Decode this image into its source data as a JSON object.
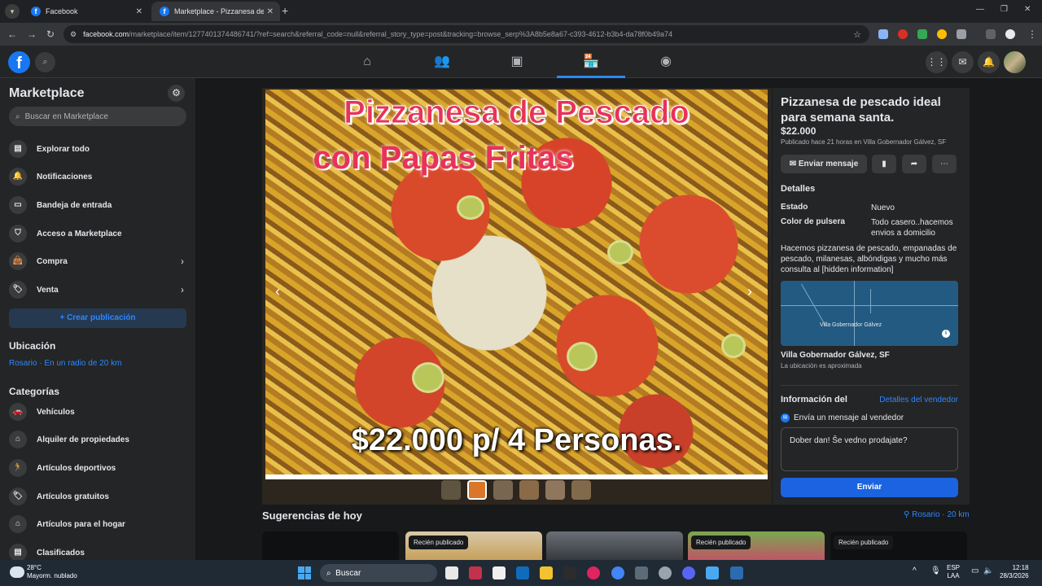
{
  "browser": {
    "tabs": [
      {
        "label": "Facebook",
        "active": false
      },
      {
        "label": "Marketplace - Pizzanesa de pesc",
        "active": true
      }
    ],
    "url_host": "facebook.com",
    "url_path": "/marketplace/item/1277401374486741/?ref=search&referral_code=null&referral_story_type=post&tracking=browse_serp%3A8b5e8a67-c393-4612-b3b4-da78f0b49a74"
  },
  "fb_header": {
    "logo": "f",
    "nav_icons": [
      "home-icon",
      "friends-icon",
      "watch-icon",
      "marketplace-icon",
      "groups-icon"
    ],
    "active_nav": "marketplace-icon",
    "right_icons": [
      "menu-grid-icon",
      "messenger-icon",
      "notifications-icon",
      "account-avatar"
    ]
  },
  "sidebar": {
    "title": "Marketplace",
    "search_placeholder": "Buscar en Marketplace",
    "items": [
      {
        "label": "Explorar todo",
        "icon": "browse-icon"
      },
      {
        "label": "Notificaciones",
        "icon": "bell-icon"
      },
      {
        "label": "Bandeja de entrada",
        "icon": "inbox-icon"
      },
      {
        "label": "Acceso a Marketplace",
        "icon": "shield-icon"
      },
      {
        "label": "Compra",
        "icon": "bag-icon",
        "chevron": true
      },
      {
        "label": "Venta",
        "icon": "tag-icon",
        "chevron": true
      }
    ],
    "create_label": "+ Crear publicación",
    "location_heading": "Ubicación",
    "location_value": "Rosario · En un radio de 20 km",
    "categories_heading": "Categorías",
    "categories": [
      {
        "label": "Vehículos",
        "icon": "car-icon"
      },
      {
        "label": "Alquiler de propiedades",
        "icon": "house-icon"
      },
      {
        "label": "Artículos deportivos",
        "icon": "running-icon"
      },
      {
        "label": "Artículos gratuitos",
        "icon": "free-tag-icon"
      },
      {
        "label": "Artículos para el hogar",
        "icon": "home-goods-icon"
      },
      {
        "label": "Clasificados",
        "icon": "classifieds-icon"
      }
    ]
  },
  "photo": {
    "caption_line1": "Pizzanesa de Pescado",
    "caption_line2": "con Papas Fritas",
    "caption_price": "$22.000 p/ 4 Personas.",
    "thumbnail_count": 6,
    "selected_thumbnail": 2
  },
  "listing": {
    "title": "Pizzanesa de pescado ideal para semana santa.",
    "price": "$22.000",
    "posted": "Publicado hace 21 horas en Villa Gobernador Gálvez, SF",
    "message_button": "Enviar mensaje",
    "details_heading": "Detalles",
    "details": [
      {
        "key": "Estado",
        "value": "Nuevo"
      },
      {
        "key": "Color de pulsera",
        "value": "Todo casero..hacemos envios a domicilio"
      }
    ],
    "description": "Hacemos pizzanesa de pescado, empanadas de pescado, milanesas, albóndigas y mucho más consulta al [hidden information]",
    "map_label": "Villa Gobernador Gálvez",
    "city": "Villa Gobernador Gálvez, SF",
    "approx": "La ubicación es aproximada",
    "seller_heading": "Información del",
    "seller_link": "Detalles del vendedor",
    "message_prompt": "Envía un mensaje al vendedor",
    "message_value": "Dober dan! Še vedno prodajate?",
    "send_label": "Enviar"
  },
  "suggestions": {
    "heading": "Sugerencias de hoy",
    "location": "Rosario · 20 km",
    "badges": [
      "Recién publicado",
      "Recién publicado",
      "Recién publicado"
    ]
  },
  "taskbar": {
    "temp": "28°C",
    "weather": "Mayorm. nublado",
    "search_label": "Buscar",
    "lang_top": "ESP",
    "lang_bottom": "LAA",
    "time": "12:18",
    "date": "28/3/2026"
  }
}
